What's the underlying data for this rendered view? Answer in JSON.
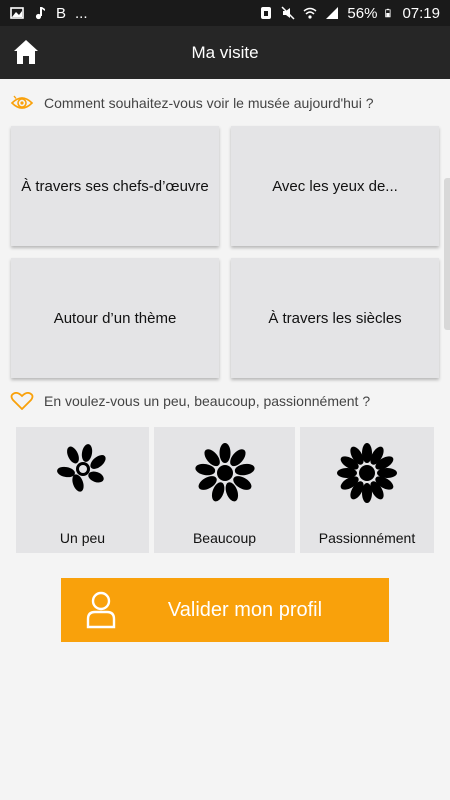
{
  "status_bar": {
    "battery": "56%",
    "time": "07:19",
    "left_text": "B",
    "dots": "..."
  },
  "app_bar": {
    "title": "Ma visite"
  },
  "view_section": {
    "question": "Comment souhaitez-vous voir le musée aujourd'hui ?",
    "options": [
      "À travers ses chefs-d’œuvre",
      "Avec les yeux de...",
      "Autour d’un thème",
      "À travers les siècles"
    ]
  },
  "love_section": {
    "question": "En voulez-vous un peu, beaucoup, passionnément ?",
    "options": [
      "Un peu",
      "Beaucoup",
      "Passionnément"
    ]
  },
  "validate_button": {
    "label": "Valider mon profil"
  },
  "colors": {
    "accent": "#f9a10b",
    "app_bar": "#262626",
    "status_bar": "#1a1a1a",
    "tile": "#e4e4e6"
  }
}
